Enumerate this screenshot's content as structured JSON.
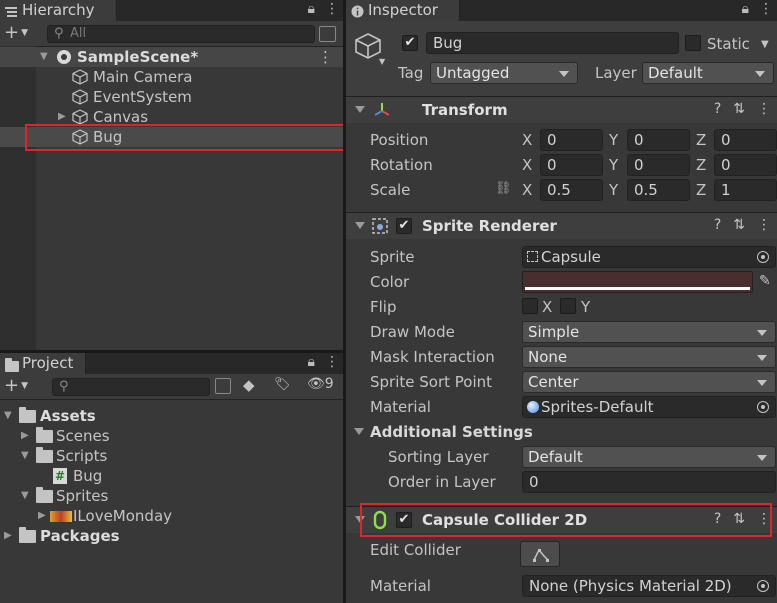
{
  "hierarchy": {
    "tab_label": "Hierarchy",
    "search_placeholder": "All",
    "scene": "SampleScene*",
    "items": [
      "Main Camera",
      "EventSystem",
      "Canvas",
      "Bug"
    ]
  },
  "project": {
    "tab_label": "Project",
    "hidden_count": "9",
    "tree": {
      "assets": "Assets",
      "scenes": "Scenes",
      "scripts": "Scripts",
      "bug_script": "Bug",
      "sprites": "Sprites",
      "ilovemonday": "ILoveMonday",
      "packages": "Packages"
    }
  },
  "inspector": {
    "tab_label": "Inspector",
    "object_name": "Bug",
    "static_label": "Static",
    "tag_label": "Tag",
    "tag_value": "Untagged",
    "layer_label": "Layer",
    "layer_value": "Default",
    "transform": {
      "title": "Transform",
      "position_label": "Position",
      "rotation_label": "Rotation",
      "scale_label": "Scale",
      "axis_x": "X",
      "axis_y": "Y",
      "axis_z": "Z",
      "position": [
        "0",
        "0",
        "0"
      ],
      "rotation": [
        "0",
        "0",
        "0"
      ],
      "scale": [
        "0.5",
        "0.5",
        "1"
      ]
    },
    "sprite_renderer": {
      "title": "Sprite Renderer",
      "sprite_label": "Sprite",
      "sprite_value": "Capsule",
      "color_label": "Color",
      "color_value": "#4a2e2e",
      "flip_label": "Flip",
      "flip_x": "X",
      "flip_y": "Y",
      "draw_mode_label": "Draw Mode",
      "draw_mode_value": "Simple",
      "mask_label": "Mask Interaction",
      "mask_value": "None",
      "sort_point_label": "Sprite Sort Point",
      "sort_point_value": "Center",
      "material_label": "Material",
      "material_value": "Sprites-Default",
      "additional_label": "Additional Settings",
      "sorting_layer_label": "Sorting Layer",
      "sorting_layer_value": "Default",
      "order_label": "Order in Layer",
      "order_value": "0"
    },
    "capsule_collider": {
      "title": "Capsule Collider 2D",
      "edit_label": "Edit Collider",
      "material_label": "Material",
      "material_value": "None (Physics Material 2D)"
    }
  },
  "colors": {
    "panel_bg": "#383838",
    "tab_bar": "#282828",
    "highlight_box": "#e0242a",
    "selected_row": "#4a4a4a",
    "collider_icon": "#8ee04a"
  }
}
